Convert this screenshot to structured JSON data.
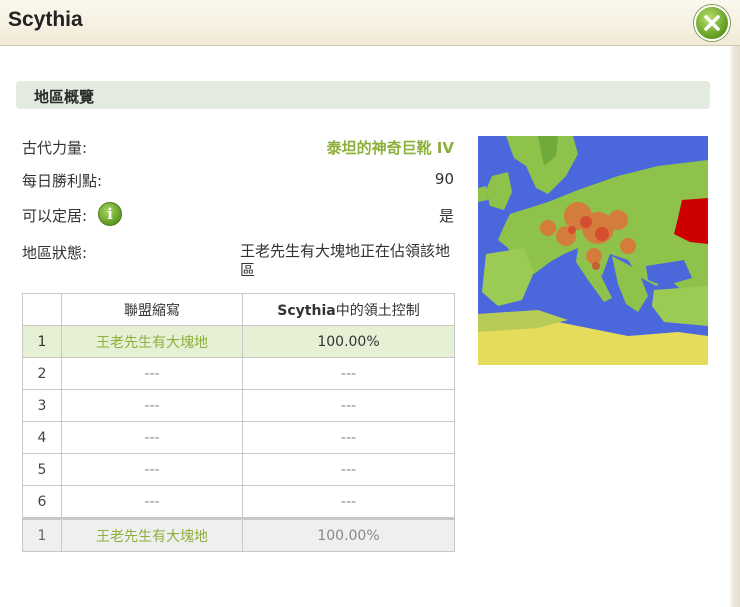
{
  "window": {
    "title": "Scythia"
  },
  "section": {
    "title": "地區概覽"
  },
  "info": {
    "ancient_power_label": "古代力量:",
    "ancient_power_value": "泰坦的神奇巨靴 IV",
    "daily_victory_label": "每日勝利點:",
    "daily_victory_value": "90",
    "settle_label": "可以定居:",
    "settle_value": "是",
    "status_label": "地區狀態:",
    "status_value": "王老先生有大塊地正在佔領該地區"
  },
  "table": {
    "headers": [
      "",
      "聯盟縮寫",
      "Scythia中的領土控制"
    ],
    "header_bold_part": "Scythia",
    "header_rest_part": "中的領土控制",
    "rows": [
      {
        "rank": "1",
        "name": "王老先生有大塊地",
        "control": "100.00%"
      },
      {
        "rank": "2",
        "name": "---",
        "control": "---"
      },
      {
        "rank": "3",
        "name": "---",
        "control": "---"
      },
      {
        "rank": "4",
        "name": "---",
        "control": "---"
      },
      {
        "rank": "5",
        "name": "---",
        "control": "---"
      },
      {
        "rank": "6",
        "name": "---",
        "control": "---"
      }
    ],
    "own_row": {
      "rank": "1",
      "name": "王老先生有大塊地",
      "control": "100.00%"
    }
  },
  "colors": {
    "accent_green": "#8db03c",
    "highlight_row": "#e6f0d4",
    "region_highlight": "#cc0000"
  },
  "icons": {
    "close": "close-icon",
    "info": "info-icon"
  }
}
